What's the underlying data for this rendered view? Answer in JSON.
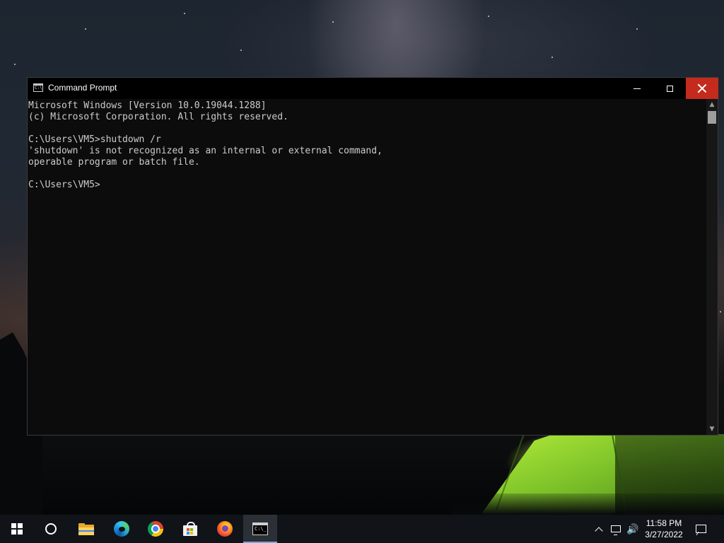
{
  "window": {
    "title": "Command Prompt",
    "icon": "cmd-icon",
    "controls": {
      "minimize": "minimize-icon",
      "maximize": "maximize-icon",
      "close": "close-icon"
    },
    "close_hover_color": "#c42b1c"
  },
  "console": {
    "background": "#0c0c0c",
    "text_color": "#cccccc",
    "lines": [
      "Microsoft Windows [Version 10.0.19044.1288]",
      "(c) Microsoft Corporation. All rights reserved.",
      "",
      "C:\\Users\\VM5>shutdown /r",
      "'shutdown' is not recognized as an internal or external command,",
      "operable program or batch file.",
      "",
      "C:\\Users\\VM5>"
    ]
  },
  "scrollbar": {
    "up_glyph": "▲",
    "down_glyph": "▼"
  },
  "taskbar": {
    "pinned": [
      {
        "name": "start",
        "icon": "windows-logo-icon"
      },
      {
        "name": "search",
        "icon": "search-icon"
      },
      {
        "name": "file-explorer",
        "icon": "folder-icon"
      },
      {
        "name": "edge",
        "icon": "edge-icon"
      },
      {
        "name": "chrome",
        "icon": "chrome-icon"
      },
      {
        "name": "microsoft-store",
        "icon": "store-icon"
      },
      {
        "name": "firefox",
        "icon": "firefox-icon"
      },
      {
        "name": "command-prompt",
        "icon": "cmd-icon",
        "active": true
      }
    ],
    "tray": {
      "icons": [
        "chevron-up-icon",
        "network-icon",
        "volume-icon"
      ],
      "volume_glyph": "🔊",
      "time": "11:58 PM",
      "date": "3/27/2022",
      "notification_icon": "notification-icon"
    },
    "active_indicator_color": "#7aa6d6"
  }
}
